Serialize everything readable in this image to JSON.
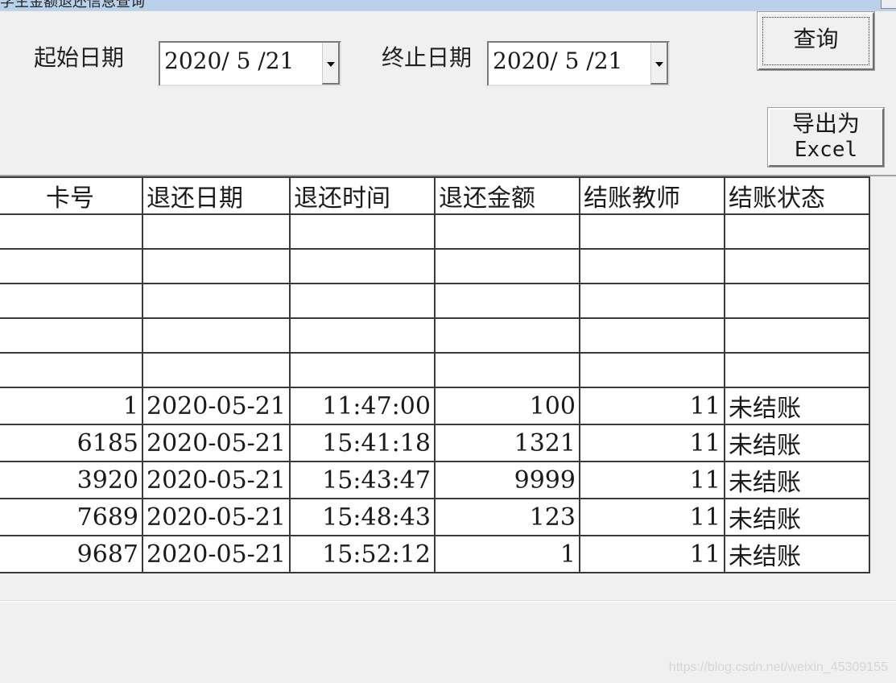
{
  "window": {
    "title": "学生金额退还信息查询"
  },
  "filters": {
    "start_label": "起始日期",
    "start_value": "2020/ 5 /21",
    "end_label": "终止日期",
    "end_value": "2020/ 5 /21"
  },
  "buttons": {
    "query": "查询",
    "export_line1": "导出为",
    "export_line2": "Excel"
  },
  "table": {
    "columns": [
      "卡号",
      "退还日期",
      "退还时间",
      "退还金额",
      "结账教师",
      "结账状态"
    ],
    "empty_rows": 5,
    "rows": [
      {
        "card": "1",
        "date": "2020-05-21",
        "time": "11:47:00",
        "amount": "100",
        "teacher": "11",
        "status": "未结账"
      },
      {
        "card": "6185",
        "date": "2020-05-21",
        "time": "15:41:18",
        "amount": "1321",
        "teacher": "11",
        "status": "未结账"
      },
      {
        "card": "3920",
        "date": "2020-05-21",
        "time": "15:43:47",
        "amount": "9999",
        "teacher": "11",
        "status": "未结账"
      },
      {
        "card": "7689",
        "date": "2020-05-21",
        "time": "15:48:43",
        "amount": "123",
        "teacher": "11",
        "status": "未结账"
      },
      {
        "card": "9687",
        "date": "2020-05-21",
        "time": "15:52:12",
        "amount": "1",
        "teacher": "11",
        "status": "未结账"
      }
    ]
  },
  "watermark": "https://blog.csdn.net/weixin_45309155"
}
